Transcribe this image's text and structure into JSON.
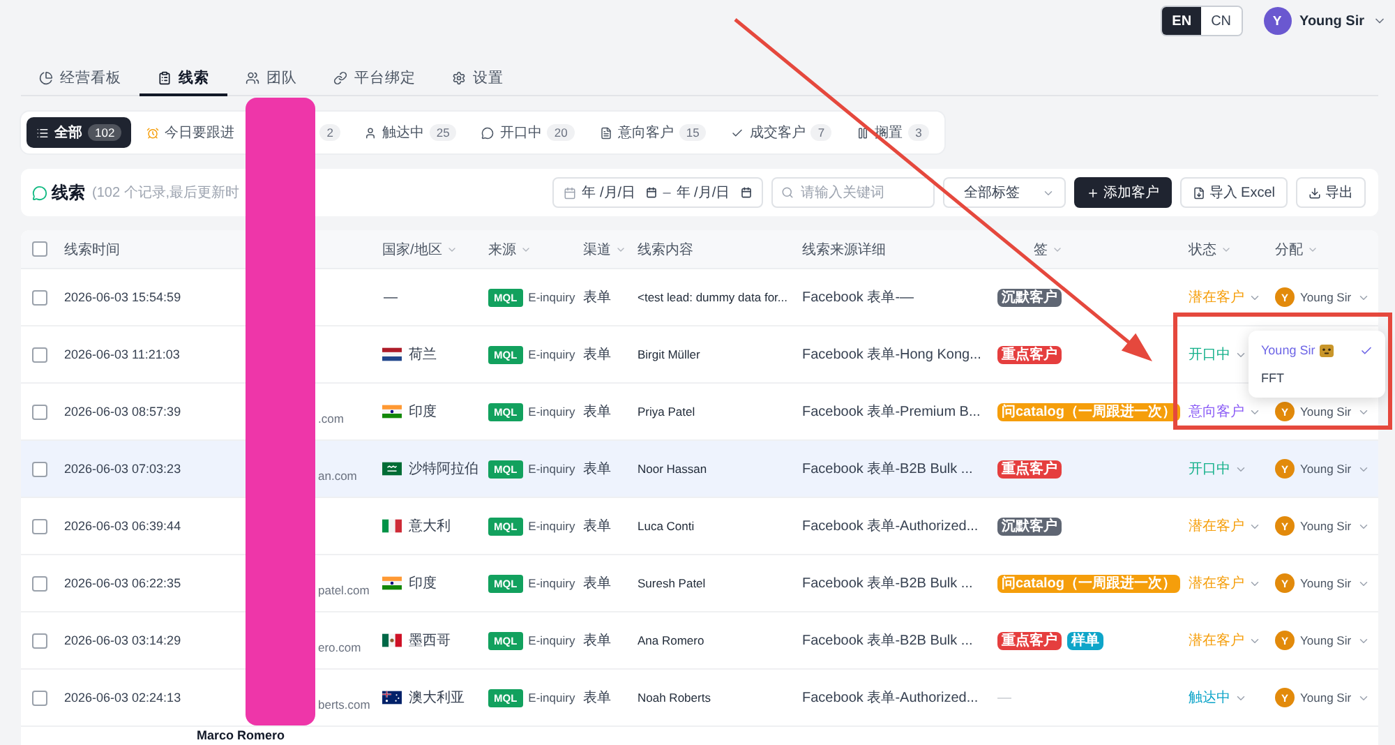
{
  "top_bar": {
    "languages": [
      {
        "label": "EN",
        "selected": true
      },
      {
        "label": "CN",
        "selected": false
      }
    ],
    "user": {
      "initial": "Y",
      "name": "Young Sir"
    }
  },
  "nav_tabs": [
    {
      "label": "经营看板",
      "selected": false
    },
    {
      "label": "线索",
      "selected": true
    },
    {
      "label": "团队",
      "selected": false
    },
    {
      "label": "平台绑定",
      "selected": false
    },
    {
      "label": "设置",
      "selected": false
    }
  ],
  "filter_tabs": [
    {
      "label": "全部",
      "count": "102",
      "selected": true
    },
    {
      "label": "今日要跟进",
      "selected": false
    },
    {
      "count": "2",
      "selected": false
    },
    {
      "label": "触达中",
      "count": "25",
      "selected": false
    },
    {
      "label": "开口中",
      "count": "20",
      "selected": false
    },
    {
      "label": "意向客户",
      "count": "15",
      "selected": false
    },
    {
      "label": "成交客户",
      "count": "7",
      "selected": false
    },
    {
      "label": "搁置",
      "count": "3",
      "selected": false
    }
  ],
  "toolbar": {
    "title": "线索",
    "subtitle": "(102 个记录,最后更新时",
    "date_range": {
      "start_placeholder": "年 /月/日",
      "separator": "–",
      "end_placeholder": "年 /月/日"
    },
    "search": {
      "placeholder": "请输入关键词"
    },
    "tag_select": {
      "value": "全部标签"
    },
    "buttons": [
      {
        "label": "添加客户",
        "kind": "primary"
      },
      {
        "label": "导入 Excel",
        "kind": "import"
      },
      {
        "label": "导出",
        "kind": "export"
      }
    ]
  },
  "table": {
    "select_all_checked": false,
    "columns": [
      {
        "label": "线索时间",
        "filter": false
      },
      {
        "label": "国家/地区",
        "filter": true
      },
      {
        "label": "来源",
        "filter": true
      },
      {
        "label": "渠道",
        "filter": true
      },
      {
        "label": "线索内容",
        "filter": false
      },
      {
        "label": "线索来源详细",
        "filter": false
      },
      {
        "label": "签",
        "filter": true
      },
      {
        "label": "状态",
        "filter": true
      },
      {
        "label": "分配",
        "filter": true
      }
    ],
    "rows": [
      {
        "checked": false,
        "highlighted": false,
        "time": "2026-06-03 15:54:59",
        "country": {
          "name": "—"
        },
        "source_badge": "MQL",
        "source": "E-inquiry",
        "channel": "表单",
        "content": "<test lead: dummy data for...",
        "source_detail": "Facebook 表单-—",
        "tags": [
          {
            "label": "沉默客户",
            "color": "#5f6673"
          }
        ],
        "status": {
          "label": "潜在客户",
          "color": "#f59e0b"
        },
        "assignee": {
          "initial": "Y",
          "name": "Young Sir"
        }
      },
      {
        "checked": false,
        "highlighted": false,
        "time": "2026-06-03 11:21:03",
        "country": {
          "name": "荷兰",
          "kind": "netherlands"
        },
        "source_badge": "MQL",
        "source": "E-inquiry",
        "channel": "表单",
        "content": "Birgit Müller",
        "source_detail": "Facebook 表单-Hong Kong...",
        "tags": [
          {
            "label": "重点客户",
            "color": "#e53e3e"
          }
        ],
        "status": {
          "label": "开口中",
          "color": "#14b08a"
        },
        "assignee_menu": {
          "options": [
            {
              "label": "Young Sir",
              "emoji": true,
              "selected": true
            },
            {
              "label": "FFT",
              "emoji": false,
              "selected": false
            }
          ]
        }
      },
      {
        "checked": false,
        "highlighted": false,
        "time": "2026-06-03 08:57:39",
        "contact_email": ".com",
        "country": {
          "name": "印度",
          "kind": "india"
        },
        "source_badge": "MQL",
        "source": "E-inquiry",
        "channel": "表单",
        "content": "Priya Patel",
        "source_detail": "Facebook 表单-Premium B...",
        "tags": [
          {
            "label": "问catalog（一周跟进一次）",
            "color": "#f59e0b"
          }
        ],
        "status": {
          "label": "意向客户",
          "color": "#8b5cf6"
        },
        "assignee": {
          "initial": "Y",
          "name": "Young Sir"
        }
      },
      {
        "checked": false,
        "highlighted": true,
        "time": "2026-06-03 07:03:23",
        "contact_email": "an.com",
        "country": {
          "name": "沙特阿拉伯",
          "kind": "saudi"
        },
        "source_badge": "MQL",
        "source": "E-inquiry",
        "channel": "表单",
        "content": "Noor Hassan",
        "source_detail": "Facebook 表单-B2B Bulk ...",
        "tags": [
          {
            "label": "重点客户",
            "color": "#e53e3e"
          }
        ],
        "status": {
          "label": "开口中",
          "color": "#14b08a"
        },
        "assignee": {
          "initial": "Y",
          "name": "Young Sir"
        }
      },
      {
        "checked": false,
        "highlighted": false,
        "time": "2026-06-03 06:39:44",
        "country": {
          "name": "意大利",
          "kind": "italy"
        },
        "source_badge": "MQL",
        "source": "E-inquiry",
        "channel": "表单",
        "content": "Luca Conti",
        "source_detail": "Facebook 表单-Authorized...",
        "tags": [
          {
            "label": "沉默客户",
            "color": "#5f6673"
          }
        ],
        "status": {
          "label": "潜在客户",
          "color": "#f59e0b"
        },
        "assignee": {
          "initial": "Y",
          "name": "Young Sir"
        }
      },
      {
        "checked": false,
        "highlighted": false,
        "time": "2026-06-03 06:22:35",
        "contact_email": "patel.com",
        "country": {
          "name": "印度",
          "kind": "india"
        },
        "source_badge": "MQL",
        "source": "E-inquiry",
        "channel": "表单",
        "content": "Suresh Patel",
        "source_detail": "Facebook 表单-B2B Bulk ...",
        "tags": [
          {
            "label": "问catalog（一周跟进一次）",
            "color": "#f59e0b"
          }
        ],
        "status": {
          "label": "潜在客户",
          "color": "#f59e0b"
        },
        "assignee": {
          "initial": "Y",
          "name": "Young Sir"
        }
      },
      {
        "checked": false,
        "highlighted": false,
        "time": "2026-06-03 03:14:29",
        "contact_email": "ero.com",
        "country": {
          "name": "墨西哥",
          "kind": "mexico"
        },
        "source_badge": "MQL",
        "source": "E-inquiry",
        "channel": "表单",
        "content": "Ana Romero",
        "source_detail": "Facebook 表单-B2B Bulk ...",
        "tags": [
          {
            "label": "重点客户",
            "color": "#e53e3e"
          },
          {
            "label": "样单",
            "color": "#0ea5c9"
          }
        ],
        "status": {
          "label": "潜在客户",
          "color": "#f59e0b"
        },
        "assignee": {
          "initial": "Y",
          "name": "Young Sir"
        }
      },
      {
        "checked": false,
        "highlighted": false,
        "time": "2026-06-03 02:24:13",
        "contact_email": "berts.com",
        "country": {
          "name": "澳大利亚",
          "kind": "australia"
        },
        "source_badge": "MQL",
        "source": "E-inquiry",
        "channel": "表单",
        "content": "Noah Roberts",
        "source_detail": "Facebook 表单-Authorized...",
        "tag_empty": "—",
        "status": {
          "label": "触达中",
          "color": "#0ea5c9"
        },
        "assignee": {
          "initial": "Y",
          "name": "Young Sir"
        }
      }
    ],
    "partial_row": {
      "contact_name": "Marco Romero"
    }
  },
  "annotations": [
    {
      "kind": "redaction"
    },
    {
      "kind": "arrow"
    },
    {
      "kind": "highlight_box"
    }
  ]
}
